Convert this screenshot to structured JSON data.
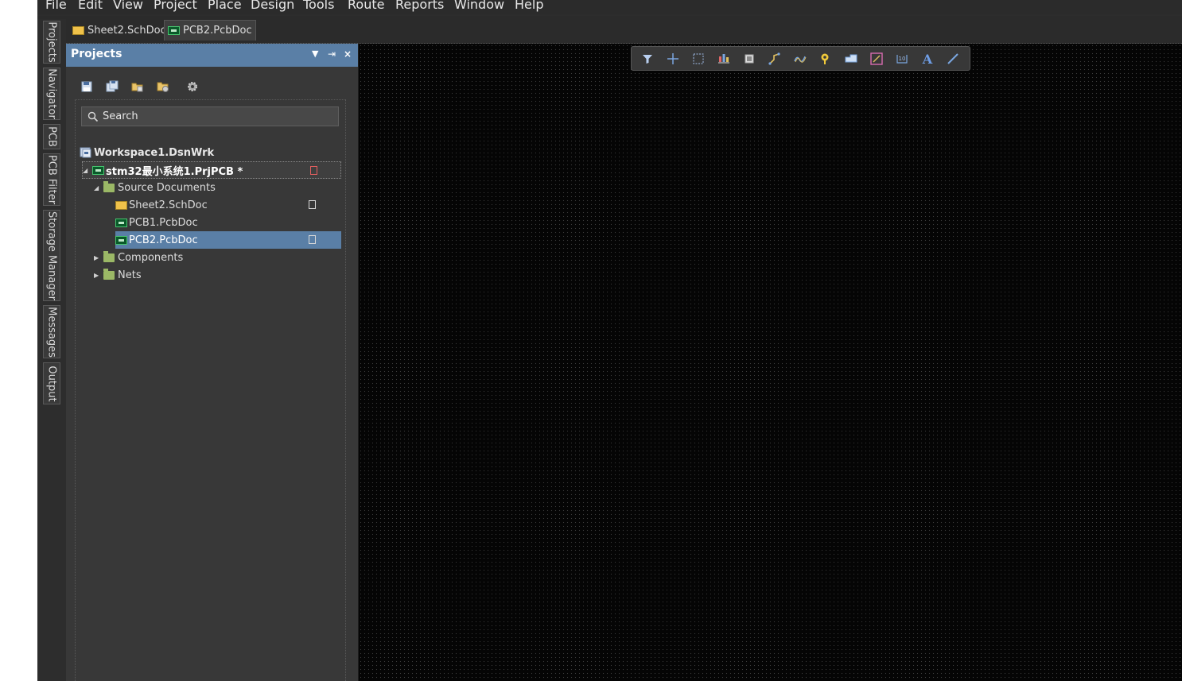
{
  "menu": [
    "File",
    "Edit",
    "View",
    "Project",
    "Place",
    "Design",
    "Tools",
    "Route",
    "Reports",
    "Window",
    "Help"
  ],
  "doc_tabs": [
    {
      "label": "Sheet2.SchDoc",
      "icon": "schematic-doc-icon",
      "active": false
    },
    {
      "label": "PCB2.PcbDoc",
      "icon": "pcb-doc-icon",
      "active": true
    }
  ],
  "side_tabs": [
    "Projects",
    "Navigator",
    "PCB",
    "PCB Filter",
    "Storage Manager",
    "Messages",
    "Output"
  ],
  "panel": {
    "title": "Projects",
    "header_buttons": [
      "dropdown-icon",
      "pin-icon",
      "close-icon"
    ],
    "toolbar_icons": [
      "save-icon",
      "save-all-icon",
      "open-project-icon",
      "add-folder-icon",
      "settings-gear-icon"
    ],
    "search_placeholder": "Search"
  },
  "tree": {
    "workspace": "Workspace1.DsnWrk",
    "project": "stm32最小系统1.PrjPCB *",
    "source_folder": "Source Documents",
    "docs": [
      "Sheet2.SchDoc",
      "PCB1.PcbDoc",
      "PCB2.PcbDoc"
    ],
    "selected": "PCB2.PcbDoc",
    "components": "Components",
    "nets": "Nets"
  },
  "canvas_toolbar": [
    "filter-icon",
    "cross-probe-icon",
    "select-rect-icon",
    "align-icon",
    "component-icon",
    "route-icon",
    "diff-pair-icon",
    "via-icon",
    "polygon-icon",
    "keepout-icon",
    "dimension-icon",
    "text-icon",
    "line-icon"
  ],
  "colors": {
    "panel_header": "#5a7fa6",
    "selection": "#5a7fa6",
    "canvas": "#050505"
  }
}
